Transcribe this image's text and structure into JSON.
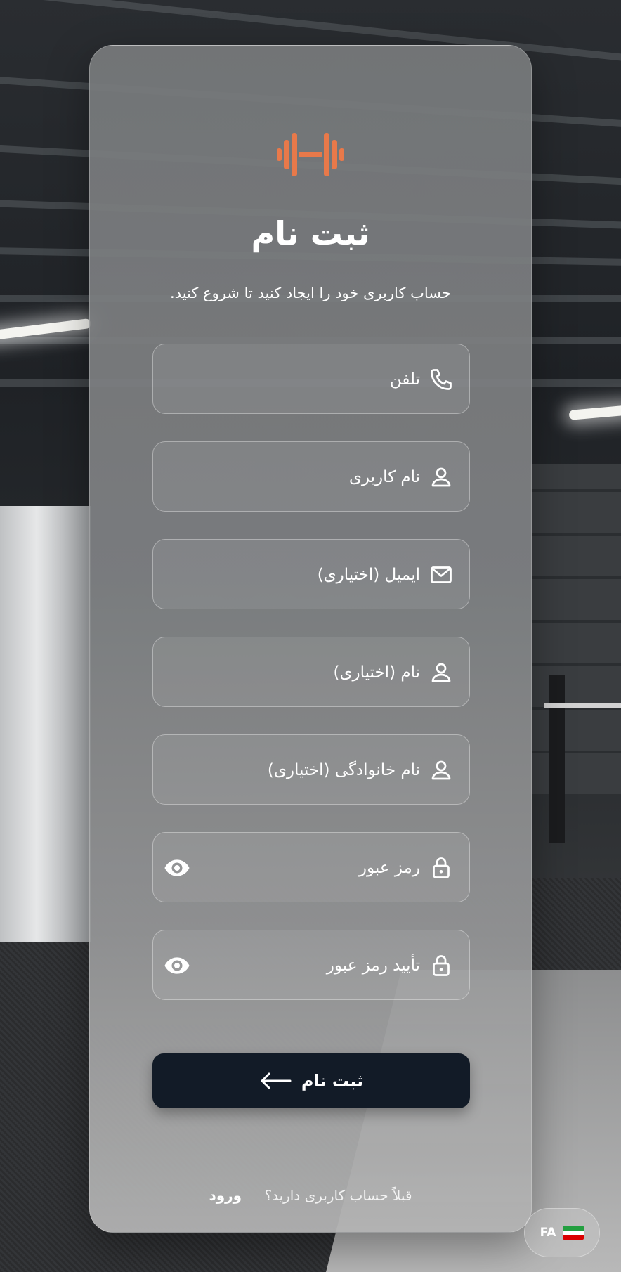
{
  "brand": {
    "accent": "#e8794a",
    "logo_icon": "dumbbell-icon"
  },
  "header": {
    "title": "ثبت نام",
    "subtitle": "حساب کاربری خود را ایجاد کنید تا شروع کنید."
  },
  "fields": [
    {
      "label": "تلفن",
      "icon": "phone-icon"
    },
    {
      "label": "نام کاربری",
      "icon": "user-icon"
    },
    {
      "label": "ایمیل (اختیاری)",
      "icon": "mail-icon"
    },
    {
      "label": "نام (اختیاری)",
      "icon": "user-icon"
    },
    {
      "label": "نام خانوادگی (اختیاری)",
      "icon": "user-icon"
    },
    {
      "label": "رمز عبور",
      "icon": "lock-icon",
      "toggle_icon": "eye-icon"
    },
    {
      "label": "تأیید رمز عبور",
      "icon": "lock-icon",
      "toggle_icon": "eye-icon"
    }
  ],
  "submit": {
    "label": "ثبت نام",
    "icon": "arrow-left-icon",
    "color": "#121b27"
  },
  "footer": {
    "question": "قبلاً حساب کاربری دارید؟",
    "login_link": "ورود"
  },
  "language": {
    "code": "FA",
    "flag_icon": "iran-flag-icon"
  }
}
